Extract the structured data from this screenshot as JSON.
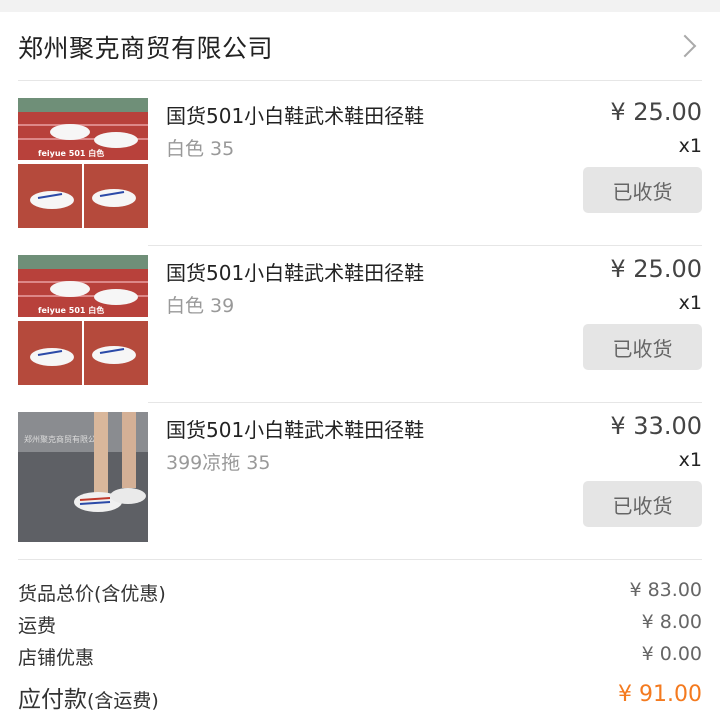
{
  "shop": {
    "name": "郑州聚克商贸有限公司"
  },
  "items": [
    {
      "title": "国货501小白鞋武术鞋田径鞋",
      "variant": "白色 35",
      "price": "¥ 25.00",
      "qty": "x1",
      "status": "已收货",
      "image_caption": "feiyue 501 白色"
    },
    {
      "title": "国货501小白鞋武术鞋田径鞋",
      "variant": "白色 39",
      "price": "¥ 25.00",
      "qty": "x1",
      "status": "已收货",
      "image_caption": "feiyue 501 白色"
    },
    {
      "title": "国货501小白鞋武术鞋田径鞋",
      "variant": "399凉拖 35",
      "price": "¥ 33.00",
      "qty": "x1",
      "status": "已收货",
      "image_caption": "郑州聚克商贸有限公司"
    }
  ],
  "summary": {
    "goods_total_label": "货品总价(含优惠)",
    "goods_total_value": "¥ 83.00",
    "shipping_label": "运费",
    "shipping_value": "¥ 8.00",
    "discount_label": "店铺优惠",
    "discount_value": "¥ 0.00",
    "payable_label": "应付款",
    "payable_sub": "(含运费)",
    "payable_value": "¥ 91.00"
  },
  "colors": {
    "accent": "#f47a1f",
    "button_bg": "#e5e5e5"
  }
}
